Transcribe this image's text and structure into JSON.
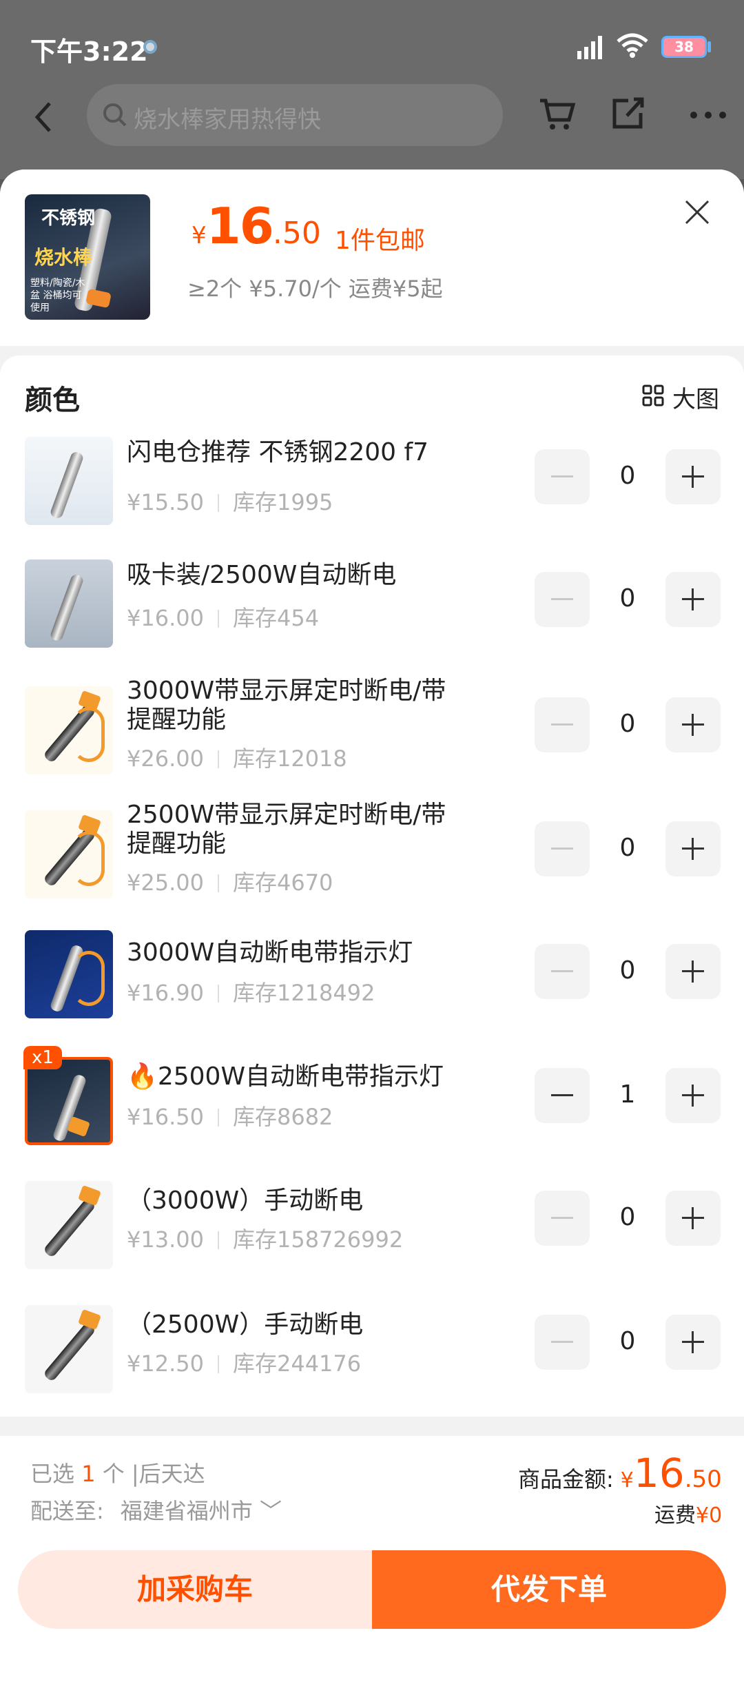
{
  "status": {
    "time": "下午3:22",
    "battery": "38"
  },
  "nav": {
    "search_placeholder": "烧水棒家用热得快"
  },
  "product": {
    "thumb_title": "不锈钢",
    "thumb_subtitle": "烧水棒",
    "thumb_note": "塑料/陶瓷/木盆 浴桶均可使用",
    "price_currency": "¥",
    "price_int": "16",
    "price_dec": ".50",
    "shipping_note": "1件包邮",
    "tier_text": "≥2个 ¥5.70/个 运费¥5起"
  },
  "spec": {
    "title": "颜色",
    "big_image_label": "大图",
    "items": [
      {
        "name": "闪电仓推荐 不锈钢2200 f7",
        "price": "¥15.50",
        "stock": "库存1995",
        "qty": "0"
      },
      {
        "name": "吸卡装/2500W自动断电",
        "price": "¥16.00",
        "stock": "库存454",
        "qty": "0"
      },
      {
        "name": "3000W带显示屏定时断电/带提醒功能",
        "price": "¥26.00",
        "stock": "库存12018",
        "qty": "0"
      },
      {
        "name": "2500W带显示屏定时断电/带提醒功能",
        "price": "¥25.00",
        "stock": "库存4670",
        "qty": "0"
      },
      {
        "name": "3000W自动断电带指示灯",
        "price": "¥16.90",
        "stock": "库存1218492",
        "qty": "0"
      },
      {
        "name": "🔥2500W自动断电带指示灯",
        "price": "¥16.50",
        "stock": "库存8682",
        "qty": "1",
        "badge": "x1"
      },
      {
        "name": "（3000W）手动断电",
        "price": "¥13.00",
        "stock": "库存158726992",
        "qty": "0"
      },
      {
        "name": "（2500W）手动断电",
        "price": "¥12.50",
        "stock": "库存244176",
        "qty": "0"
      }
    ]
  },
  "footer": {
    "selected_prefix": "已选",
    "selected_count": "1",
    "selected_suffix": "个 |后天达",
    "deliver_label": "配送至:",
    "deliver_city": "福建省福州市 ﹀",
    "total_label": "商品金额:",
    "total_currency": "¥",
    "total_int": "16",
    "total_dec": ".50",
    "freight_label": "运费",
    "freight_value": "¥0",
    "add_cart_label": "加采购车",
    "order_label": "代发下单"
  },
  "colors": {
    "accent": "#ff5000",
    "order_button": "#ff6a1f",
    "cart_button_bg": "#ffe9e0"
  }
}
